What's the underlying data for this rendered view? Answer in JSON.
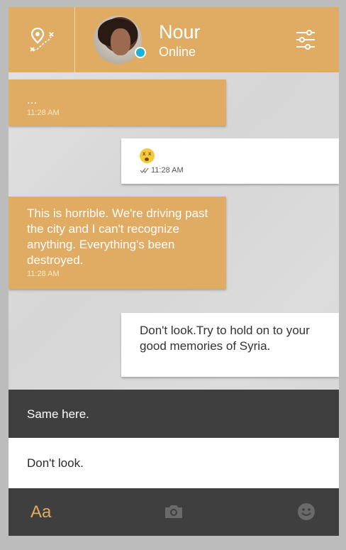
{
  "contact": {
    "name": "Nour",
    "status": "Online"
  },
  "messages": [
    {
      "direction": "incoming",
      "text": "...",
      "time": "11:28 AM"
    },
    {
      "direction": "outgoing",
      "text": "",
      "emoji": "dizzy-face",
      "time": "11:28 AM",
      "read": true
    },
    {
      "direction": "incoming",
      "text": "This is horrible. We're driving past the city and I can't recognize anything. Everything's been destroyed.",
      "time": "11:28 AM"
    },
    {
      "direction": "outgoing",
      "text": "Don't look.Try to hold on to your good memories of Syria."
    }
  ],
  "reply_options": [
    {
      "text": "Same here."
    },
    {
      "text": "Don't look."
    }
  ],
  "toolbar": {
    "font_label": "Aa"
  },
  "colors": {
    "accent": "#e0ab62",
    "dark": "#3f3f3f",
    "online": "#1fb0d8"
  },
  "icons": [
    "map-route-icon",
    "settings-sliders-icon",
    "double-check-icon",
    "camera-icon",
    "smiley-icon"
  ]
}
